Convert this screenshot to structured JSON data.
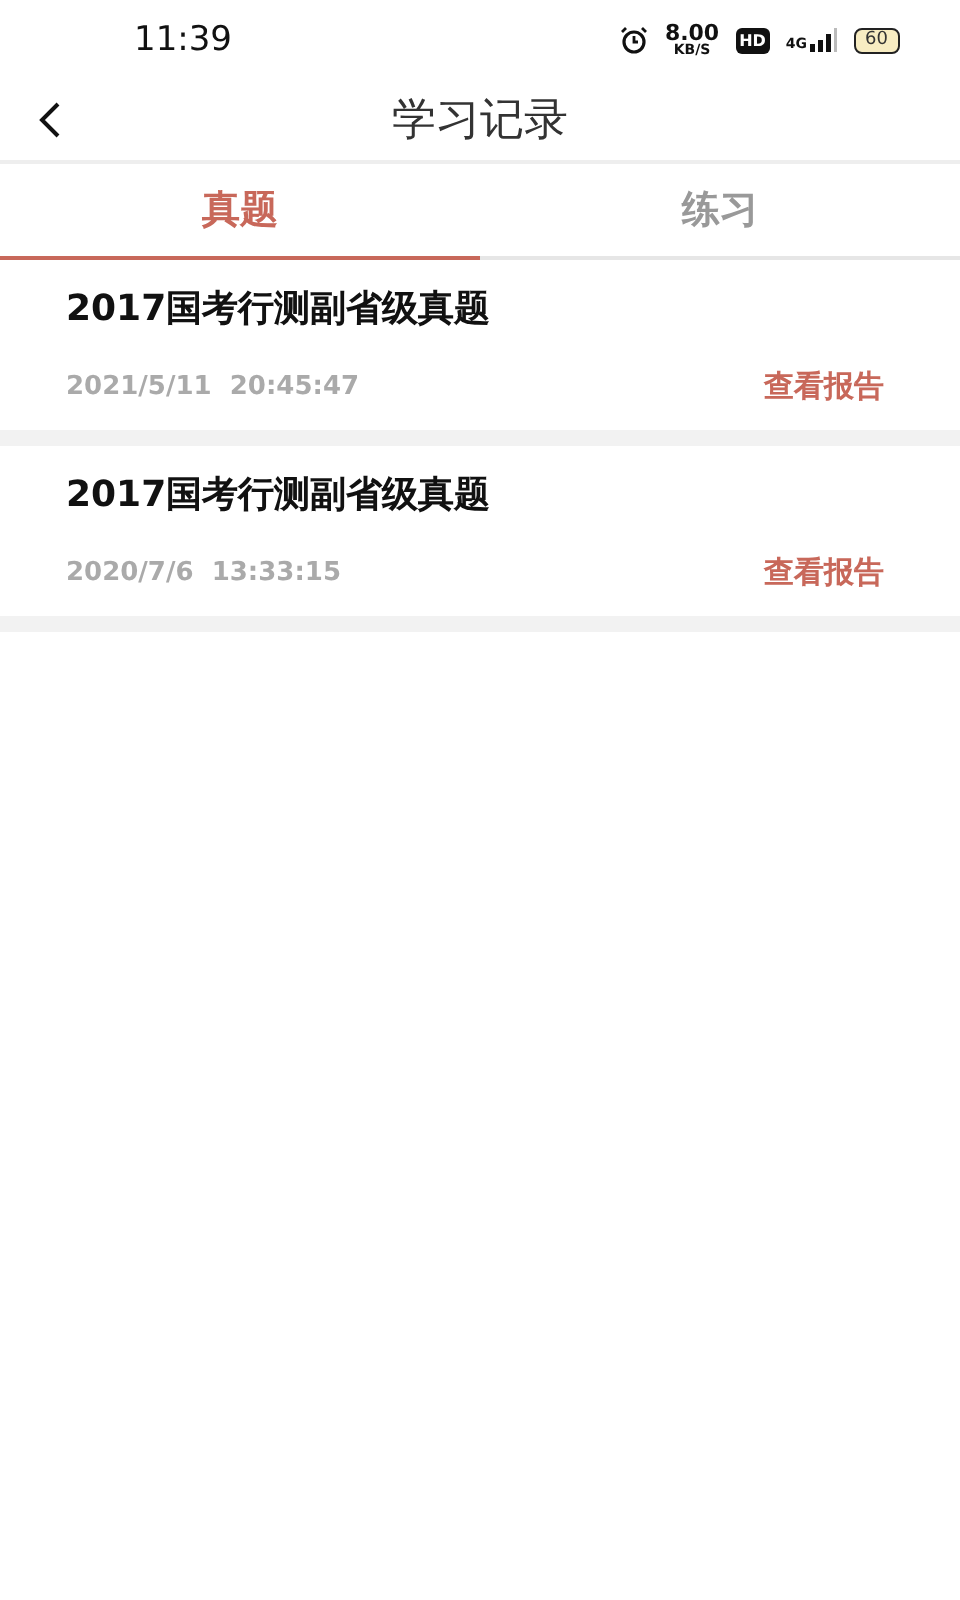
{
  "status_bar": {
    "time": "11:39",
    "speed": "8.00",
    "speed_unit": "KB/S",
    "hd": "HD",
    "network": "4G",
    "battery": "60"
  },
  "header": {
    "title": "学习记录"
  },
  "tabs": [
    {
      "label": "真题",
      "selected": true
    },
    {
      "label": "练习",
      "selected": false
    }
  ],
  "records": [
    {
      "title": "2017国考行测副省级真题",
      "time": "2021/5/11  20:45:47",
      "action": "查看报告"
    },
    {
      "title": "2017国考行测副省级真题",
      "time": "2020/7/6  13:33:15",
      "action": "查看报告"
    }
  ]
}
